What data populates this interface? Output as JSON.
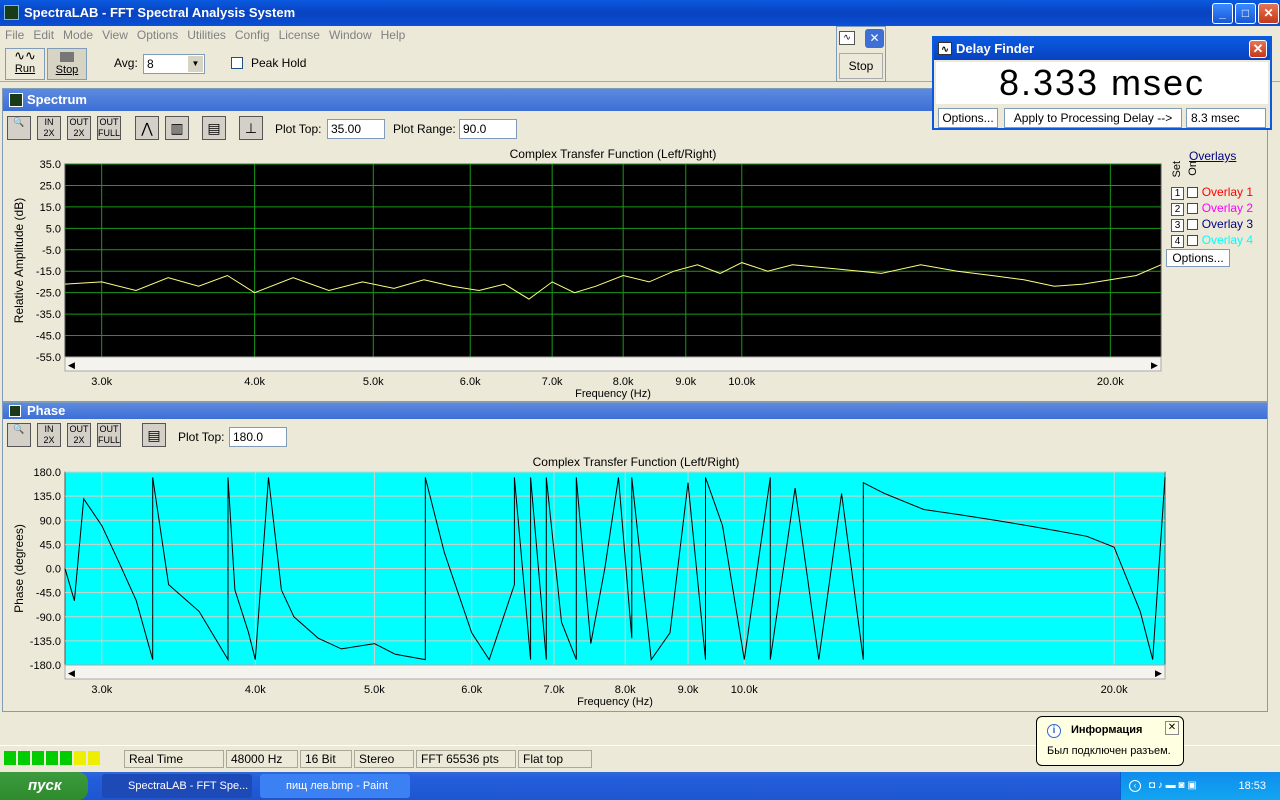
{
  "window": {
    "title": "SpectraLAB - FFT Spectral Analysis System"
  },
  "menu": [
    "File",
    "Edit",
    "Mode",
    "View",
    "Options",
    "Utilities",
    "Config",
    "License",
    "Window",
    "Help"
  ],
  "toolbar": {
    "run_label": "Run",
    "stop_label": "Stop",
    "avg_label": "Avg:",
    "avg_value": "8",
    "peak_hold_label": "Peak Hold",
    "stop_button": "Stop"
  },
  "delay_finder": {
    "title": "Delay Finder",
    "value": "8.333 msec",
    "options_label": "Options...",
    "apply_label": "Apply to Processing Delay -->",
    "processing_delay": "8.3 msec"
  },
  "spectrum": {
    "title": "Spectrum",
    "plot_top_label": "Plot Top:",
    "plot_top_value": "35.00",
    "plot_range_label": "Plot Range:",
    "plot_range_value": "90.0",
    "zoom_in": "IN 2X",
    "zoom_out": "OUT 2X",
    "zoom_full": "OUT FULL",
    "overlays_title": "Overlays",
    "set_label": "Set",
    "on_label": "On",
    "options_label": "Options...",
    "overlays": [
      {
        "n": "1",
        "name": "Overlay 1",
        "color": "#ff0000"
      },
      {
        "n": "2",
        "name": "Overlay 2",
        "color": "#ff00ff"
      },
      {
        "n": "3",
        "name": "Overlay 3",
        "color": "#000080"
      },
      {
        "n": "4",
        "name": "Overlay 4",
        "color": "#00ffff"
      }
    ]
  },
  "phase": {
    "title": "Phase",
    "plot_top_label": "Plot Top:",
    "plot_top_value": "180.0"
  },
  "chart_data": [
    {
      "type": "line",
      "title": "Complex Transfer Function (Left/Right)",
      "xlabel": "Frequency (Hz)",
      "ylabel": "Relative Amplitude (dB)",
      "x_scale": "log",
      "xlim": [
        2800,
        22000
      ],
      "ylim": [
        -55,
        35
      ],
      "grid": true,
      "background": "#000000",
      "line_color": "#ffff80",
      "y_ticks": [
        "35.0",
        "25.0",
        "15.0",
        "5.0",
        "-5.0",
        "-15.0",
        "-25.0",
        "-35.0",
        "-45.0",
        "-55.0"
      ],
      "x_ticks": [
        {
          "v": 3000,
          "t": "3.0k"
        },
        {
          "v": 4000,
          "t": "4.0k"
        },
        {
          "v": 5000,
          "t": "5.0k"
        },
        {
          "v": 6000,
          "t": "6.0k"
        },
        {
          "v": 7000,
          "t": "7.0k"
        },
        {
          "v": 8000,
          "t": "8.0k"
        },
        {
          "v": 9000,
          "t": "9.0k"
        },
        {
          "v": 10000,
          "t": "10.0k"
        },
        {
          "v": 20000,
          "t": "20.0k"
        }
      ],
      "x": [
        2800,
        3000,
        3200,
        3400,
        3600,
        3800,
        4000,
        4300,
        4600,
        4900,
        5200,
        5500,
        5800,
        6100,
        6400,
        6700,
        7000,
        7300,
        7600,
        8000,
        8400,
        8800,
        9200,
        9600,
        10000,
        10500,
        11000,
        12000,
        13000,
        14000,
        15000,
        16000,
        17000,
        18000,
        19000,
        20000,
        21000,
        22000
      ],
      "y": [
        -21,
        -20,
        -24,
        -18,
        -22,
        -17,
        -25,
        -18,
        -24,
        -20,
        -23,
        -19,
        -22,
        -24,
        -21,
        -28,
        -20,
        -25,
        -22,
        -17,
        -20,
        -15,
        -12,
        -16,
        -11,
        -15,
        -12,
        -14,
        -16,
        -12,
        -15,
        -17,
        -19,
        -22,
        -21,
        -19,
        -17,
        -12
      ]
    },
    {
      "type": "line",
      "title": "Complex Transfer Function (Left/Right)",
      "xlabel": "Frequency (Hz)",
      "ylabel": "Phase (degrees)",
      "x_scale": "log",
      "xlim": [
        2800,
        22000
      ],
      "ylim": [
        -180,
        180
      ],
      "grid": true,
      "background": "#00ffff",
      "line_color": "#000000",
      "y_ticks": [
        "180.0",
        "135.0",
        "90.0",
        "45.0",
        "0.0",
        "-45.0",
        "-90.0",
        "-135.0",
        "-180.0"
      ],
      "x_ticks": [
        {
          "v": 3000,
          "t": "3.0k"
        },
        {
          "v": 4000,
          "t": "4.0k"
        },
        {
          "v": 5000,
          "t": "5.0k"
        },
        {
          "v": 6000,
          "t": "6.0k"
        },
        {
          "v": 7000,
          "t": "7.0k"
        },
        {
          "v": 8000,
          "t": "8.0k"
        },
        {
          "v": 9000,
          "t": "9.0k"
        },
        {
          "v": 10000,
          "t": "10.0k"
        },
        {
          "v": 20000,
          "t": "20.0k"
        }
      ],
      "x": [
        2800,
        2850,
        2900,
        3000,
        3100,
        3200,
        3300,
        3300,
        3400,
        3600,
        3800,
        3800,
        3850,
        3950,
        4000,
        4100,
        4200,
        4300,
        4500,
        4700,
        5000,
        5200,
        5500,
        5500,
        5700,
        6000,
        6200,
        6500,
        6500,
        6700,
        6700,
        6900,
        6900,
        7100,
        7300,
        7300,
        7500,
        7700,
        7900,
        8100,
        8100,
        8400,
        8700,
        9000,
        9300,
        9300,
        9600,
        10000,
        10500,
        10500,
        11000,
        11500,
        12000,
        12500,
        12500,
        13000,
        14000,
        15000,
        16000,
        17000,
        18000,
        19000,
        20000,
        21000,
        21500,
        22000
      ],
      "y": [
        0,
        -60,
        130,
        80,
        10,
        -60,
        -170,
        170,
        -30,
        -80,
        -170,
        170,
        -40,
        -120,
        -170,
        170,
        -40,
        -90,
        -130,
        -150,
        -140,
        -160,
        -170,
        170,
        30,
        -120,
        -170,
        -30,
        170,
        -170,
        170,
        -170,
        170,
        -100,
        -170,
        170,
        -140,
        0,
        170,
        -130,
        170,
        -170,
        -120,
        160,
        -170,
        170,
        80,
        -170,
        170,
        -170,
        150,
        -170,
        140,
        -170,
        160,
        140,
        110,
        100,
        90,
        80,
        70,
        60,
        40,
        -80,
        -170,
        170
      ]
    }
  ],
  "status": {
    "mode": "Real Time",
    "rate": "48000 Hz",
    "bits": "16 Bit",
    "channels": "Stereo",
    "fft": "FFT 65536 pts",
    "window": "Flat top"
  },
  "taskbar": {
    "start": "пуск",
    "task1": "SpectraLAB - FFT Spe...",
    "task2": "пищ лев.bmp - Paint",
    "clock": "18:53"
  },
  "balloon": {
    "title": "Информация",
    "text": "Был подключен разъем."
  }
}
